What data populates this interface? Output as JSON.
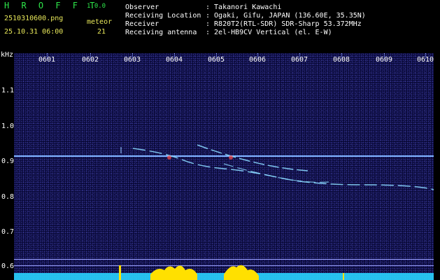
{
  "app": {
    "title": "H R O F F T",
    "version": "1.0.0"
  },
  "file": {
    "name": "2510310600.png",
    "datetime": "25.10.31 06:00"
  },
  "meteor": {
    "label": "meteor",
    "count": "21"
  },
  "metadata": [
    {
      "label": "Observer",
      "value": ": Takanori Kawachi"
    },
    {
      "label": "Receiving Location",
      "value": ": Ogaki, Gifu, JAPAN (136.60E, 35.35N)"
    },
    {
      "label": "Receiver",
      "value": ": R820T2(RTL-SDR) SDR-Sharp 53.372MHz"
    },
    {
      "label": "Receiving antenna",
      "value": ": 2el-HB9CV Vertical (el. E-W)"
    }
  ],
  "axis": {
    "y_unit": "kHz",
    "time_labels": [
      "0601",
      "0602",
      "0603",
      "0604",
      "0605",
      "0606",
      "0607",
      "0608",
      "0609",
      "0610"
    ],
    "freq_labels": [
      "1.1",
      "1.0",
      "0.9",
      "0.8",
      "0.7",
      "0.6"
    ]
  },
  "colors": {
    "title": "#2ee64a",
    "file": "#e8e85a",
    "carrier": "#7fb4ff",
    "trace": "#8ad8ff",
    "activity": "#ffe000",
    "baseline": "#29d3ff"
  }
}
